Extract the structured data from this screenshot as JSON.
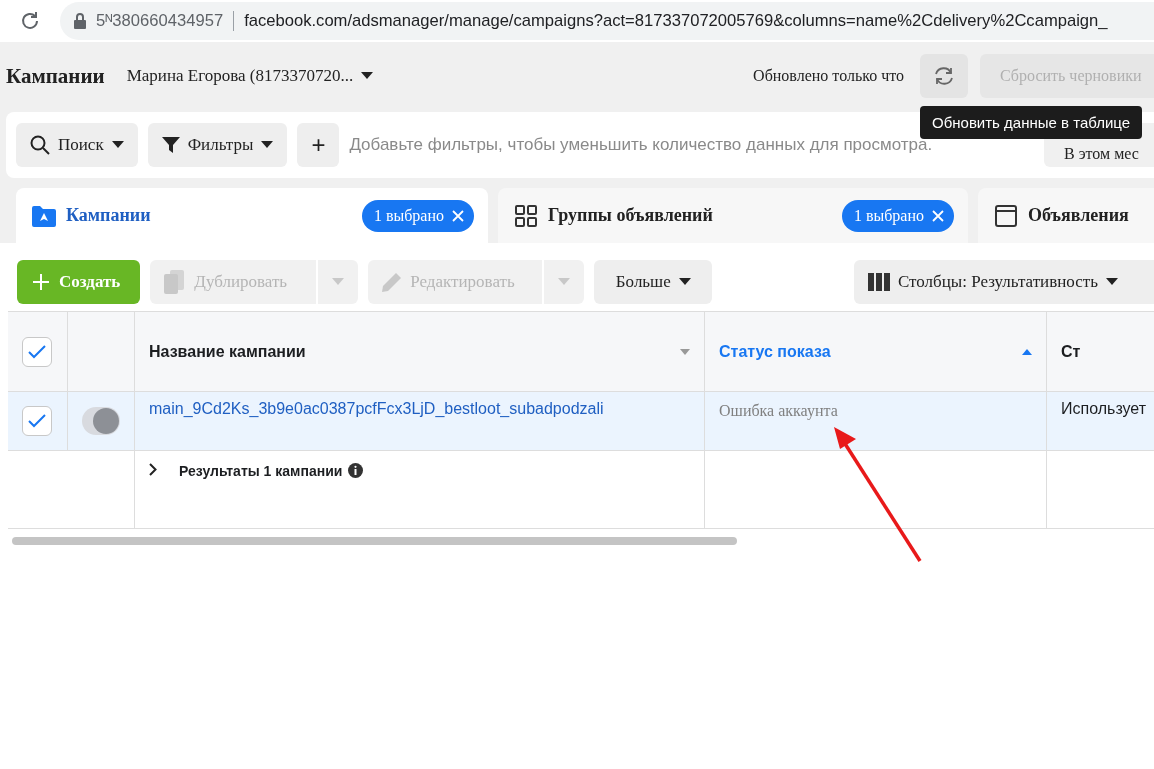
{
  "browser": {
    "url_prefix": "5ᴺ380660434957",
    "url": "facebook.com/adsmanager/manage/campaigns?act=817337072005769&columns=name%2Cdelivery%2Ccampaign_"
  },
  "header": {
    "title": "Кампании",
    "account": "Марина Егорова (8173370720...",
    "updated": "Обновлено только что",
    "discard_button": "Сбросить черновики",
    "tooltip": "Обновить данные в таблице"
  },
  "filter_bar": {
    "search": "Поиск",
    "filters": "Фильтры",
    "add": "+",
    "placeholder": "Добавьте фильтры, чтобы уменьшить количество данных для просмотра.",
    "date": "В этом мес"
  },
  "tabs": [
    {
      "kind": "campaigns",
      "label": "Кампании",
      "badge": "1 выбрано",
      "selected": true
    },
    {
      "kind": "adsets",
      "label": "Группы объявлений",
      "badge": "1 выбрано",
      "selected": false
    },
    {
      "kind": "ads",
      "label": "Объявления",
      "selected": false
    }
  ],
  "toolbar": [
    {
      "kind": "create",
      "label": "Создать",
      "disabled": false
    },
    {
      "kind": "duplicate",
      "label": "Дублировать",
      "disabled": true
    },
    {
      "kind": "edit",
      "label": "Редактировать",
      "disabled": true
    },
    {
      "kind": "more",
      "label": "Больше",
      "disabled": false
    },
    {
      "kind": "columns",
      "label": "Столбцы: Результативность",
      "disabled": false
    }
  ],
  "table": {
    "header_checked": true,
    "columns": [
      {
        "label": "Название кампании",
        "sorted": false
      },
      {
        "label": "Статус показа",
        "sorted": true
      },
      {
        "label": "Ст",
        "sorted": false
      }
    ],
    "rows": [
      {
        "checked": true,
        "on": true,
        "name": "main_9Cd2Ks_3b9e0ac0387pcfFcx3LjD_bestloot_subadpodzali",
        "status": "Ошибка аккаунта",
        "column_3": "Использует"
      }
    ],
    "summary": "Результаты 1 кампании"
  },
  "annotation": {
    "kind": "arrow"
  }
}
